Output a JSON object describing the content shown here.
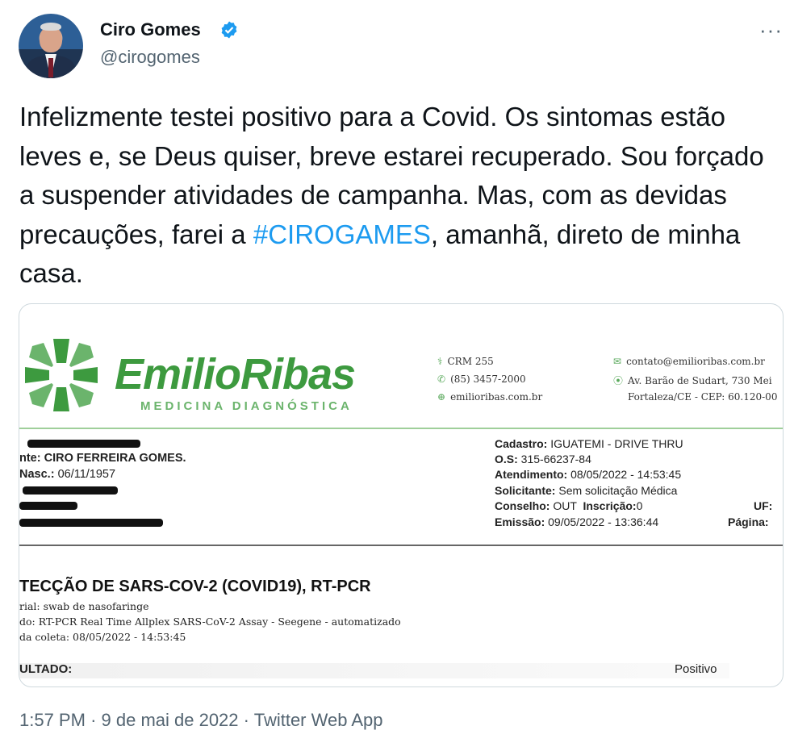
{
  "author": {
    "name": "Ciro Gomes",
    "handle": "@cirogomes",
    "verified_icon": "verified-badge-icon",
    "more_label": "···"
  },
  "tweet": {
    "text_before": "Infelizmente testei positivo para a Covid. Os sintomas estão leves e, se Deus quiser, breve estarei recuperado. Sou forçado a suspender atividades de campanha. Mas, com as devidas precauções, farei a ",
    "hashtag": "#CIROGAMES",
    "text_after": ", amanhã, direto de minha casa."
  },
  "media": {
    "brand_name": "EmilioRibas",
    "brand_subtitle": "MEDICINA DIAGNÓSTICA",
    "contacts_left": [
      "CRM 255",
      "(85) 3457-2000",
      "emilioribas.com.br"
    ],
    "contacts_right": [
      "contato@emilioribas.com.br",
      "Av. Barão de Sudart, 730 Mei",
      "Fortaleza/CE - CEP: 60.120-00"
    ],
    "patient": {
      "name_label": "nte:",
      "name_value": "CIRO FERREIRA GOMES.",
      "birth_label": "Nasc.:",
      "birth_value": "06/11/1957"
    },
    "record": {
      "cadastro_label": "Cadastro:",
      "cadastro_value": "IGUATEMI - DRIVE THRU",
      "os_label": "O.S:",
      "os_value": "315-66237-84",
      "atendimento_label": "Atendimento:",
      "atendimento_value": "08/05/2022 - 14:53:45",
      "solicitante_label": "Solicitante:",
      "solicitante_value": "Sem solicitação Médica",
      "conselho_label": "Conselho:",
      "conselho_value": "OUT",
      "inscricao_label": "Inscrição:",
      "inscricao_value": "0",
      "uf_label": "UF:",
      "emissao_label": "Emissão:",
      "emissao_value": "09/05/2022 - 13:36:44",
      "pagina_label": "Página:"
    },
    "exam": {
      "title": "TECÇÃO DE SARS-COV-2 (COVID19), RT-PCR",
      "material": "rial:  swab de nasofaringe",
      "method": "do:    RT-PCR Real Time Allplex SARS-CoV-2 Assay - Seegene - automatizado",
      "collection": "da coleta:  08/05/2022 - 14:53:45",
      "result_label": "ULTADO:",
      "result_value": "Positivo"
    }
  },
  "footer": {
    "time": "1:57 PM",
    "date": "9 de mai de 2022",
    "source": "Twitter Web App",
    "separator": "·"
  },
  "colors": {
    "text": "#0f1419",
    "secondary": "#536471",
    "link": "#1d9bf0",
    "brand_green": "#3d9a3f"
  }
}
